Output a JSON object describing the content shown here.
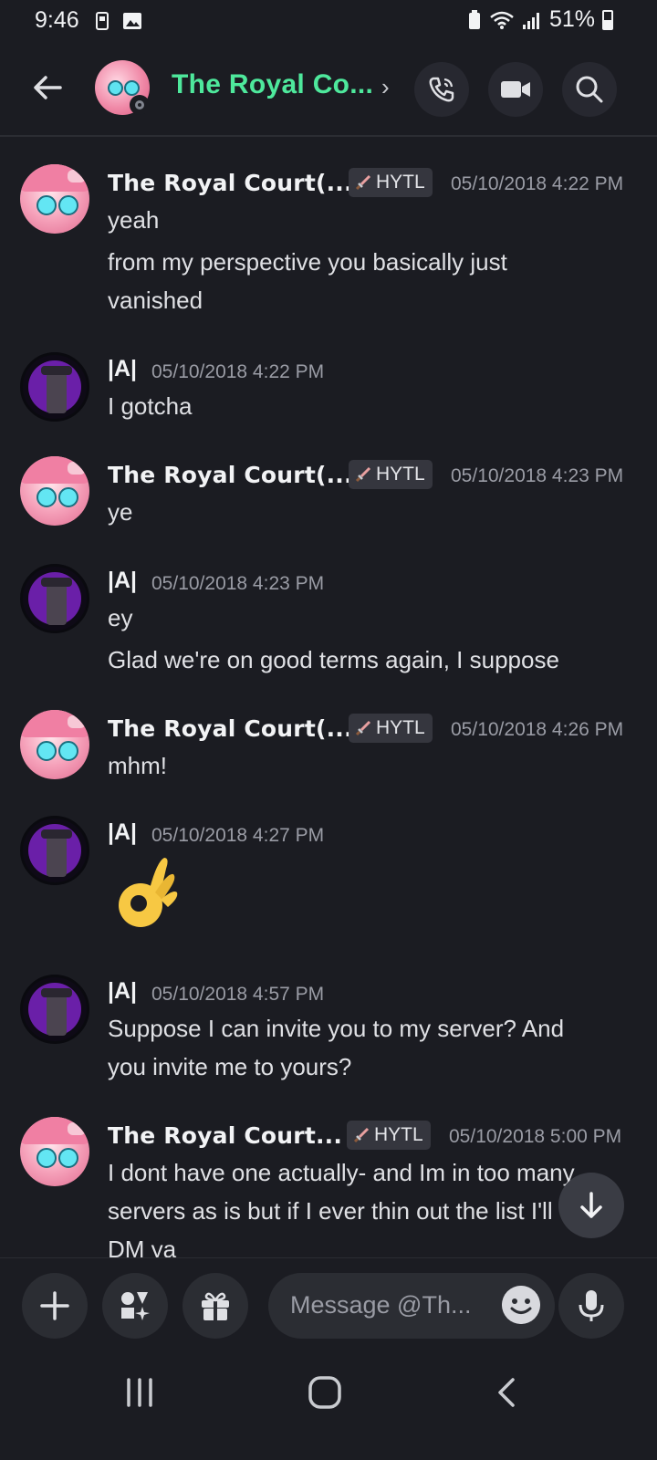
{
  "status_bar": {
    "time": "9:46",
    "battery": "51%"
  },
  "header": {
    "title": "The Royal Co...",
    "chevron": "›"
  },
  "messages": [
    {
      "author": "The Royal Court(...",
      "role": "HYTL",
      "timestamp": "05/10/2018 4:22 PM",
      "lines": [
        "yeah",
        "from my perspective you basically just",
        "vanished"
      ]
    },
    {
      "author": "|A|",
      "timestamp": "05/10/2018 4:22 PM",
      "lines": [
        "I gotcha"
      ]
    },
    {
      "author": "The Royal Court(...",
      "role": "HYTL",
      "timestamp": "05/10/2018 4:23 PM",
      "lines": [
        "ye"
      ]
    },
    {
      "author": "|A|",
      "timestamp": "05/10/2018 4:23 PM",
      "lines": [
        "ey",
        "Glad we're on good terms again, I suppose"
      ]
    },
    {
      "author": "The Royal Court(...",
      "role": "HYTL",
      "timestamp": "05/10/2018 4:26 PM",
      "lines": [
        "mhm!"
      ]
    },
    {
      "author": "|A|",
      "timestamp": "05/10/2018 4:27 PM",
      "emoji": "ok-hand"
    },
    {
      "author": "|A|",
      "timestamp": "05/10/2018 4:57 PM",
      "lines": [
        "Suppose I can invite you to my server? And",
        "you invite me to yours?"
      ]
    },
    {
      "author": "The Royal Court...",
      "role": "HYTL",
      "timestamp": "05/10/2018 5:00 PM",
      "lines": [
        "I dont have one actually- and Im in too many",
        "servers as is but if I ever thin out the list I'll",
        "DM ya"
      ]
    }
  ],
  "composer": {
    "placeholder": "Message @Th..."
  },
  "icons": {
    "back": "arrow-left-icon",
    "call": "phone-icon",
    "video": "video-camera-icon",
    "search": "search-icon",
    "add": "plus-icon",
    "apps": "apps-icon",
    "gift": "gift-icon",
    "emoji": "smiley-icon",
    "mic": "microphone-icon",
    "jump": "arrow-down-icon",
    "role": "sword-icon"
  },
  "colors": {
    "background": "#1b1c22",
    "channel_title": "#4ee89c",
    "timestamp": "#9a9ca5"
  }
}
